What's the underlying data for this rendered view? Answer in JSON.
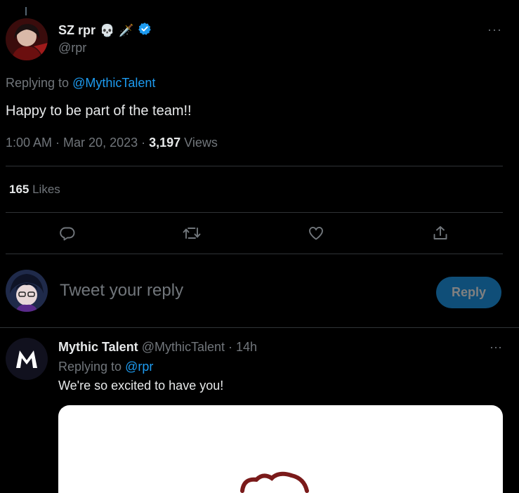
{
  "tweet": {
    "display_name": "SZ rpr",
    "emoji_1": "💀",
    "emoji_2": "🗡️",
    "handle": "@rpr",
    "replying_prefix": "Replying to ",
    "replying_to": "@MythicTalent",
    "text": "Happy to be part of the team!!",
    "time": "1:00 AM",
    "sep1": " · ",
    "date": "Mar 20, 2023",
    "sep2": " · ",
    "views_count": "3,197",
    "views_label": " Views",
    "likes_count": "165",
    "likes_label": " Likes",
    "more_label": "···"
  },
  "icons": {
    "verified": "verified-badge-icon",
    "reply": "reply-icon",
    "retweet": "retweet-icon",
    "like": "heart-icon",
    "share": "share-icon"
  },
  "reply_composer": {
    "placeholder": "Tweet your reply",
    "button_label": "Reply"
  },
  "replies": [
    {
      "display_name": "Mythic Talent",
      "handle": "@MythicTalent",
      "sep": " · ",
      "time": "14h",
      "replying_prefix": "Replying to ",
      "replying_to": "@rpr",
      "text": "We're so excited to have you!",
      "more_label": "···"
    }
  ],
  "colors": {
    "background": "#000000",
    "accent": "#1d9bf0",
    "muted": "#71767b",
    "text": "#e7e9ea",
    "reply_button_bg": "#0f4e78"
  }
}
